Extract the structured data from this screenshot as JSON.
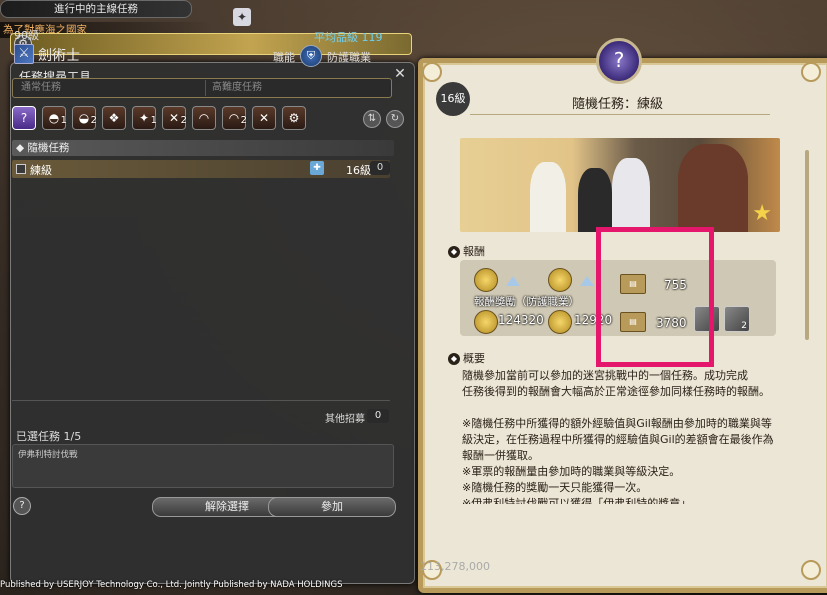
{
  "hud": {
    "quest_tab": "進行中的主線任務",
    "quest_text": "為了對應海之國家",
    "footer_copyright": "Published by USERJOY Technology Co., Ltd. Jointly Published by NADA HOLDINGS",
    "footer_gil": "113,278,000"
  },
  "duty_finder": {
    "title": "任務搜尋工具",
    "level": "90級",
    "job": "劍術士",
    "avg_ilvl": "平均品級 119",
    "role_label": "職能",
    "role": "防護職業",
    "search_tabs": [
      "通常任務",
      "高難度任務"
    ],
    "category_badges": [
      "",
      "1",
      "2",
      "",
      "1",
      "2",
      "",
      "2",
      "",
      ""
    ],
    "category_header": "隨機任務",
    "duty_row": {
      "name": "練級",
      "level": "16級",
      "count": "0"
    },
    "other_recruit_label": "其他招募",
    "other_recruit_count": "0",
    "selected_label": "已選任務 1/5",
    "selected_item": "伊弗利特討伐戰",
    "help": "?",
    "clear_button": "解除選擇",
    "join_button": "參加"
  },
  "detail": {
    "level_badge": "16級",
    "title": "隨機任務：練級",
    "reward_header": "報酬",
    "reward_label": "報酬獎勵（防護職業）",
    "exp_value": "124320",
    "gil_value": "12920",
    "seal_value_1": "755",
    "seal_value_2": "3780",
    "item_qty": "2",
    "summary_header": "概要",
    "summary_lines": [
      "隨機參加當前可以參加的迷宮挑戰中的一個任務。成功完成",
      "任務後得到的報酬會大幅高於正常途徑參加同樣任務時的報酬。",
      "",
      "※隨機任務中所獲得的額外經驗值與Gil報酬由參加時的職業與等",
      "級決定，在任務過程中所獲得的經驗值與Gil的差額會在最後作為",
      "報酬一併獲取。",
      "※軍票的報酬量由參加時的職業與等級決定。",
      "※隨機任務的獎勵一天只能獲得一次。",
      "※伊弗利特討伐戰可以獲得「伊弗利特的獎章」"
    ]
  },
  "colors": {
    "highlight": "#e5176c",
    "avg_ilvl": "#6fd0f0",
    "panel_frame": "#b89a5a"
  },
  "icons": [
    "gear-icon",
    "close-icon",
    "job-gladiator-icon",
    "tank-role-icon",
    "random-duty-icon",
    "checkbox-icon",
    "help-icon",
    "exp-icon",
    "gil-icon",
    "seal-icon"
  ]
}
